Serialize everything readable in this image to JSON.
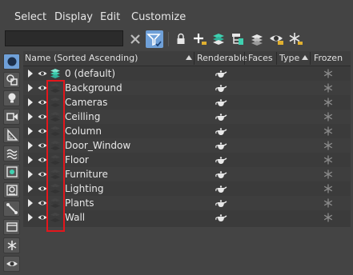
{
  "menu": {
    "select": "Select",
    "display": "Display",
    "edit": "Edit",
    "customize": "Customize"
  },
  "search": {
    "value": "",
    "placeholder": ""
  },
  "toolbar": {
    "icons": [
      "clear-search-icon",
      "filter-icon",
      "lock-icon",
      "add-to-layer-icon",
      "layers-icon",
      "nest-icon",
      "layer-stack-icon",
      "hide-icon",
      "freeze-icon"
    ],
    "accent": "#6fa0d8"
  },
  "left_toolbar": {
    "icons": [
      "geometry-icon",
      "shapes-icon",
      "lights-icon",
      "cameras-icon",
      "helpers-icon",
      "spacewarps-icon",
      "groups-icon",
      "xrefs-icon",
      "bones-icon",
      "containers-icon",
      "frozen-icon",
      "hidden-icon"
    ]
  },
  "header": {
    "name": "Name (Sorted Ascending)",
    "renderable": "Renderable",
    "faces": "Faces",
    "type": "Type",
    "frozen": "Frozen"
  },
  "rows": [
    {
      "label": "0 (default)",
      "active": true
    },
    {
      "label": "Background",
      "active": false
    },
    {
      "label": "Cameras",
      "active": false
    },
    {
      "label": "Ceilling",
      "active": false
    },
    {
      "label": "Column",
      "active": false
    },
    {
      "label": "Door_Window",
      "active": false
    },
    {
      "label": "Floor",
      "active": false
    },
    {
      "label": "Furniture",
      "active": false
    },
    {
      "label": "Lighting",
      "active": false
    },
    {
      "label": "Plants",
      "active": false
    },
    {
      "label": "Wall",
      "active": false
    }
  ],
  "colors": {
    "highlight": "#e4161c",
    "active_layer": "#3fd0b0"
  }
}
